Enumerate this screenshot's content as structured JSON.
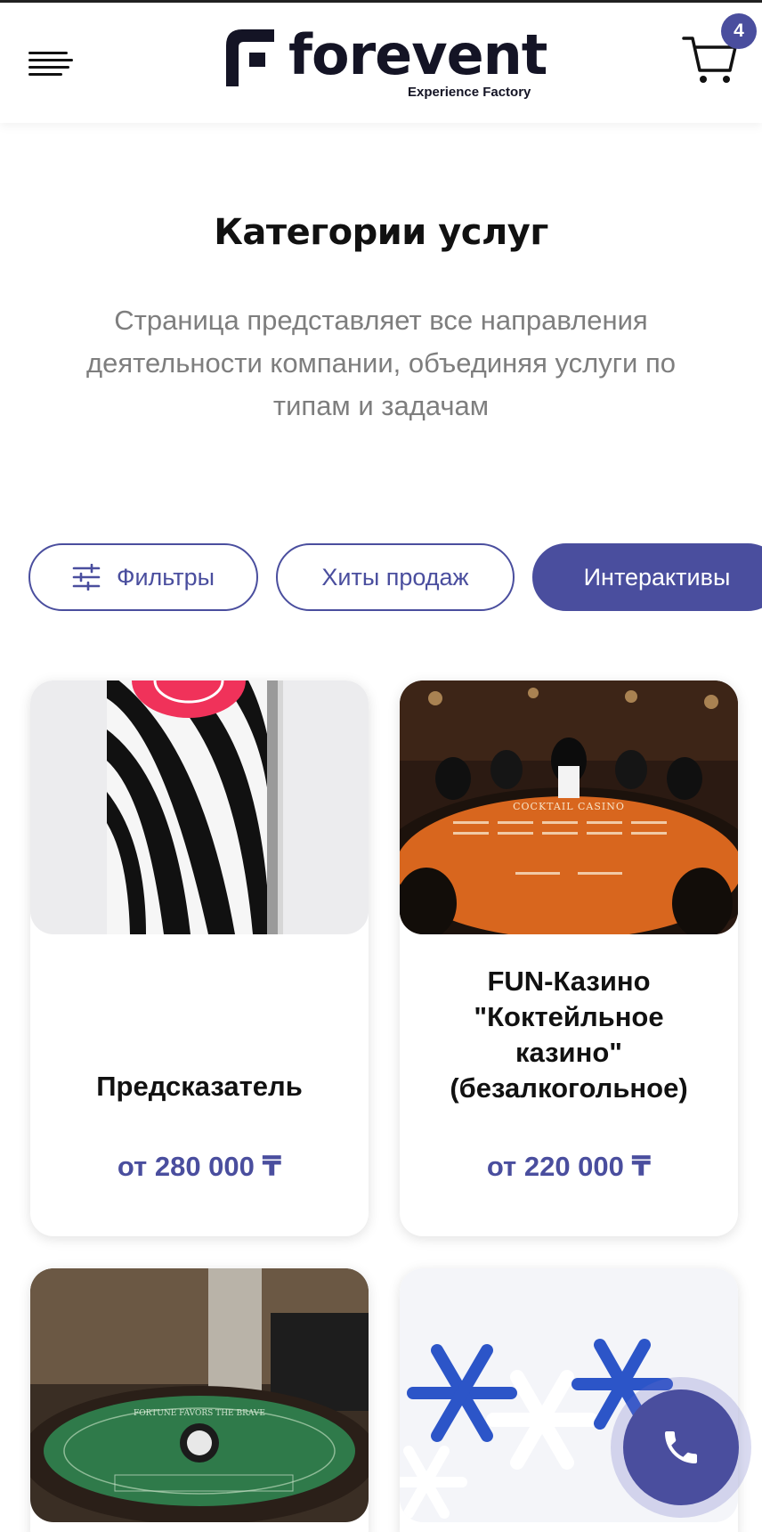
{
  "header": {
    "logo_text": "forevent",
    "logo_tagline": "Experience Factory",
    "menu_icon": "hamburger-menu-icon",
    "cart_icon": "shopping-cart-icon",
    "cart_count": "4"
  },
  "page": {
    "title": "Категории услуг",
    "description": "Страница представляет все направления деятельности компании, объединяя услуги по типам и задачам"
  },
  "filters": {
    "filters_label": "Фильтры",
    "filters_icon": "sliders-icon",
    "chips": [
      "Хиты продаж",
      "Интерактивы"
    ],
    "active_chip": "Интерактивы"
  },
  "cards": [
    {
      "title": "Предсказатель",
      "price": "от 280 000 ₸"
    },
    {
      "title": "FUN-Казино \"Коктейльное казино\" (безалкогольное)",
      "price": "от 220 000 ₸",
      "image_text": "COCKTAIL CASINO"
    },
    {
      "title": "",
      "price": "",
      "image_text": "FORTUNE FAVORS THE BRAVE"
    },
    {
      "title": "",
      "price": ""
    }
  ],
  "call_button_icon": "phone-icon",
  "colors": {
    "accent": "#4a4e9e",
    "text": "#111111",
    "muted": "#7e7e7e"
  }
}
